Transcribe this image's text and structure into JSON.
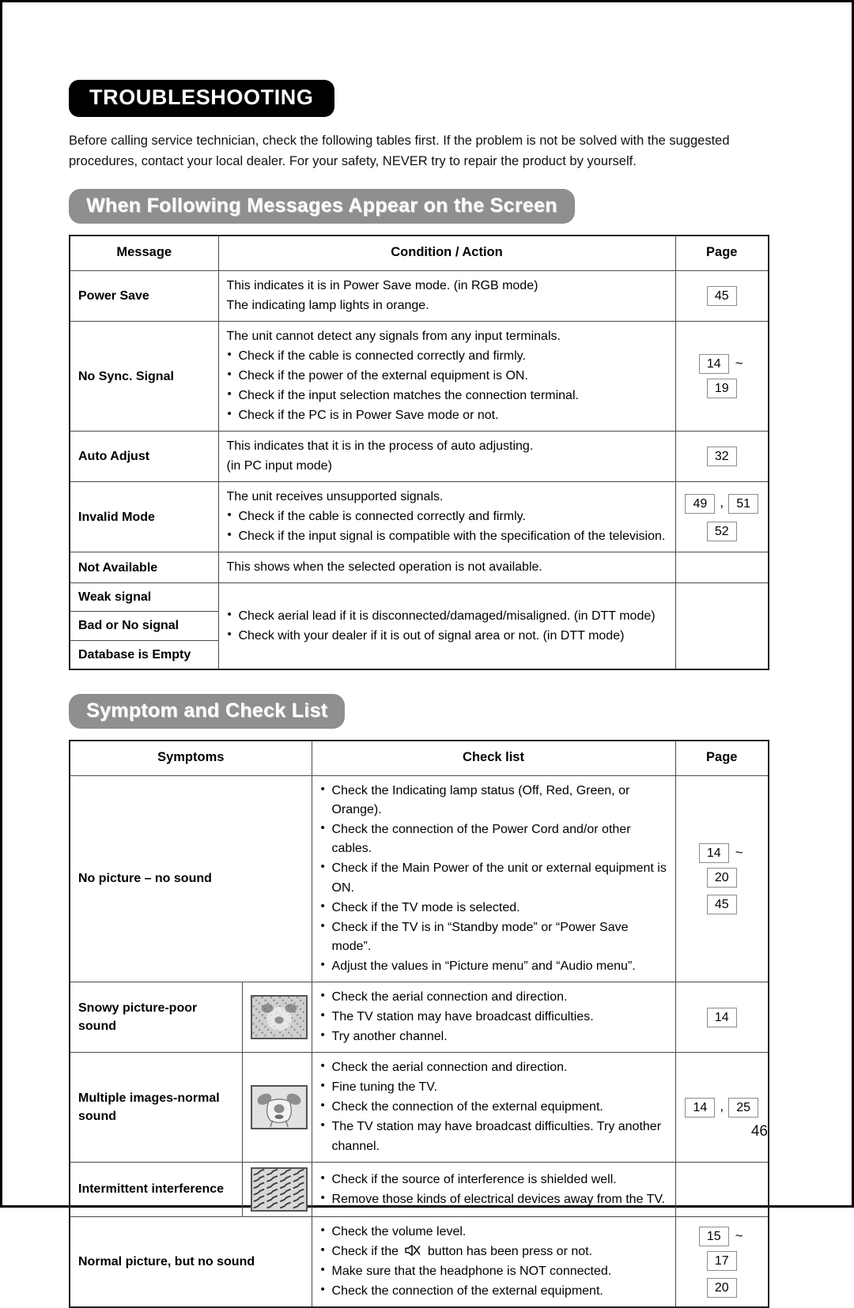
{
  "document": {
    "title": "TROUBLESHOOTING",
    "intro": "Before calling service technician, check the following tables first. If the problem is not be solved with the suggested procedures, contact your local dealer. For your safety, NEVER try to repair the product by yourself.",
    "page_number": "46"
  },
  "section1": {
    "banner": "When Following Messages Appear on the Screen",
    "headers": {
      "message": "Message",
      "condition": "Condition / Action",
      "page": "Page"
    },
    "rows": [
      {
        "label": "Power Save",
        "lines": [
          {
            "type": "plain",
            "text": "This indicates it is in Power Save mode. (in RGB mode)"
          },
          {
            "type": "plain",
            "text": "The indicating lamp lights in orange."
          }
        ],
        "pages": [
          {
            "items": [
              "45"
            ]
          }
        ]
      },
      {
        "label": "No Sync. Signal",
        "lines": [
          {
            "type": "plain",
            "text": "The unit cannot detect any signals from any input terminals."
          },
          {
            "type": "bullet",
            "text": "Check if the cable is connected correctly and firmly."
          },
          {
            "type": "bullet",
            "text": "Check if the power of the external equipment is ON."
          },
          {
            "type": "bullet",
            "text": "Check if the input selection matches the connection terminal."
          },
          {
            "type": "bullet",
            "text": "Check if the PC is in Power Save mode or not."
          }
        ],
        "pages": [
          {
            "items": [
              "14",
              "~",
              "19"
            ]
          }
        ]
      },
      {
        "label": "Auto Adjust",
        "lines": [
          {
            "type": "plain",
            "text": "This indicates that it is in the process of auto adjusting."
          },
          {
            "type": "plain",
            "text": "(in PC input mode)"
          }
        ],
        "pages": [
          {
            "items": [
              "32"
            ]
          }
        ]
      },
      {
        "label": "Invalid Mode",
        "lines": [
          {
            "type": "plain",
            "text": "The unit receives unsupported signals."
          },
          {
            "type": "bullet",
            "text": "Check if the cable is connected correctly and firmly."
          },
          {
            "type": "bullet",
            "text": "Check if the input signal is compatible with the specification of the television."
          }
        ],
        "pages": [
          {
            "items": [
              "49",
              ",",
              "51"
            ]
          },
          {
            "items": [
              "52"
            ]
          }
        ]
      },
      {
        "label": "Not Available",
        "lines": [
          {
            "type": "plain",
            "text": "This shows when the selected operation is not available."
          }
        ],
        "pages": []
      }
    ],
    "grouped": {
      "labels": [
        "Weak signal",
        "Bad or No signal",
        "Database is Empty"
      ],
      "lines": [
        {
          "type": "bullet",
          "text": "Check aerial lead if it is disconnected/damaged/misaligned. (in DTT mode)"
        },
        {
          "type": "bullet",
          "text": "Check with your dealer if it is out of signal area or not. (in DTT mode)"
        }
      ],
      "pages": []
    }
  },
  "section2": {
    "banner": "Symptom and Check List",
    "headers": {
      "symptoms": "Symptoms",
      "checklist": "Check list",
      "page": "Page"
    },
    "rows": [
      {
        "label": "No picture – no sound",
        "thumbnail": null,
        "lines": [
          {
            "type": "bullet",
            "text": "Check the Indicating lamp status (Off, Red, Green, or Orange)."
          },
          {
            "type": "bullet",
            "text": "Check the connection of the Power Cord and/or other cables."
          },
          {
            "type": "bullet",
            "text": "Check if the Main Power of the unit or external equipment is"
          },
          {
            "type": "cont",
            "text": "ON."
          },
          {
            "type": "bullet",
            "text": "Check if the TV mode is selected."
          },
          {
            "type": "bullet",
            "text": "Check if the TV is in “Standby mode” or “Power Save mode”."
          },
          {
            "type": "bullet",
            "text": "Adjust the values in “Picture menu” and “Audio menu”."
          }
        ],
        "pages": [
          {
            "items": [
              "14",
              "~",
              "20"
            ]
          },
          {
            "items": [
              "45"
            ]
          }
        ]
      },
      {
        "label": "Snowy picture-poor sound",
        "thumbnail": "snowy-picture-thumbnail",
        "lines": [
          {
            "type": "bullet",
            "text": "Check the aerial connection and direction."
          },
          {
            "type": "bullet",
            "text": "The TV station may have broadcast difficulties."
          },
          {
            "type": "bullet",
            "text": "Try another channel."
          }
        ],
        "pages": [
          {
            "items": [
              "14"
            ]
          }
        ]
      },
      {
        "label": "Multiple images-normal sound",
        "thumbnail": "ghosting-picture-thumbnail",
        "lines": [
          {
            "type": "bullet",
            "text": "Check the aerial connection and direction."
          },
          {
            "type": "bullet",
            "text": "Fine tuning the TV."
          },
          {
            "type": "bullet",
            "text": "Check the connection of the external equipment."
          },
          {
            "type": "bullet",
            "text": "The TV station may have broadcast difficulties. Try another"
          },
          {
            "type": "cont",
            "text": "channel."
          }
        ],
        "pages": [
          {
            "items": [
              "14",
              ",",
              "25"
            ]
          }
        ]
      },
      {
        "label": "Intermittent interference",
        "thumbnail": "interference-pattern-thumbnail",
        "lines": [
          {
            "type": "bullet",
            "text": "Check if the source of interference is shielded well."
          },
          {
            "type": "bullet",
            "text": "Remove those kinds of electrical devices away from the TV."
          }
        ],
        "pages": []
      },
      {
        "label": "Normal picture, but no sound",
        "thumbnail": null,
        "lines": [
          {
            "type": "bullet",
            "text": "Check the volume level."
          },
          {
            "type": "bullet-mute",
            "text_before": "Check if the ",
            "text_after": " button has been press or not."
          },
          {
            "type": "bullet",
            "text": "Make sure that the headphone is NOT connected."
          },
          {
            "type": "bullet",
            "text": "Check the connection of the external equipment."
          }
        ],
        "pages": [
          {
            "items": [
              "15",
              "~",
              "17"
            ]
          },
          {
            "items": [
              "20"
            ]
          }
        ]
      }
    ]
  },
  "colors": {
    "title_pill_bg": "#000000",
    "banner_bg": "#8f8f8f",
    "banner_text": "#ffffff",
    "table_border": "#4a4a4a",
    "thumbnail_bg": "#d4d4d4"
  }
}
